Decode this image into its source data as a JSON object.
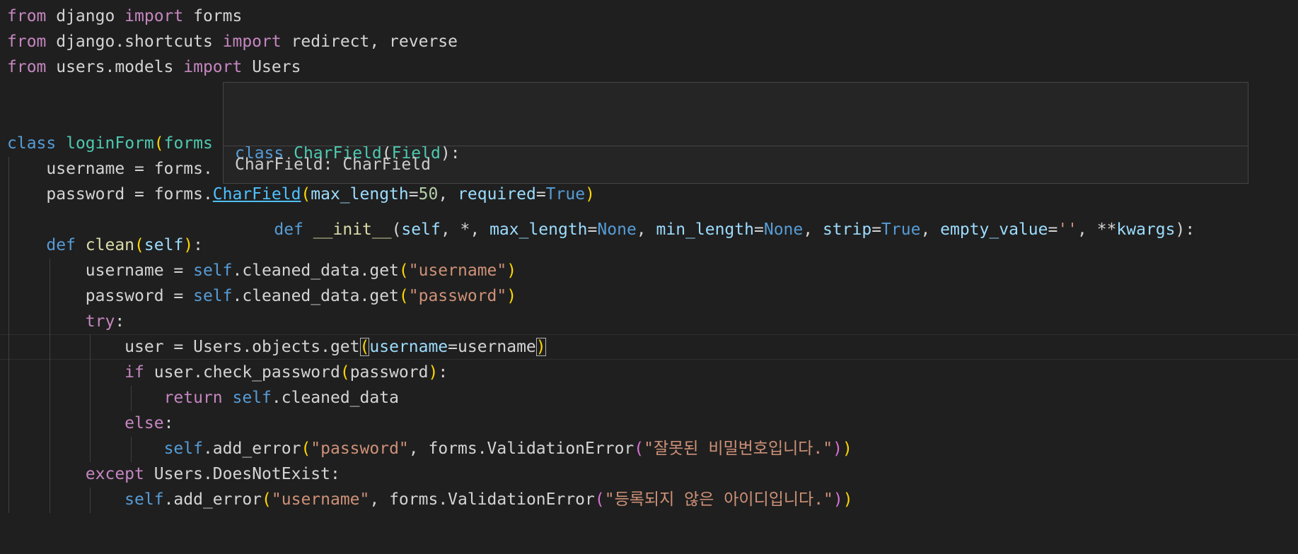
{
  "editor": {
    "lines": {
      "l1": {
        "from": "from",
        "mod": " django ",
        "import": "import",
        "name": " forms"
      },
      "l2": {
        "from": "from",
        "mod": " django.shortcuts ",
        "import": "import",
        "names": " redirect, reverse"
      },
      "l3": {
        "from": "from",
        "mod": " users.models ",
        "import": "import",
        "name": " Users"
      },
      "l6": {
        "kw": "class",
        "name": "loginForm",
        "paren": "(",
        "base": "forms"
      },
      "l7": {
        "indent": "    ",
        "var": "username",
        "rest": " = forms."
      },
      "l8": {
        "indent": "    ",
        "var": "password",
        "mid": " = forms.",
        "link": "CharField",
        "open": "(",
        "param1": "max_length",
        "eq1": "=",
        "num": "50",
        "comma": ", ",
        "param2": "required",
        "eq2": "=",
        "val": "True",
        "close": ")"
      },
      "l10": {
        "indent": "    ",
        "kw": "def",
        "name": "clean",
        "open": "(",
        "self": "self",
        "close": ")",
        "colon": ":"
      },
      "l11": {
        "indent": "        ",
        "var": "username",
        "eq": " = ",
        "self": "self",
        "rest": ".cleaned_data.get",
        "open": "(",
        "str": "\"username\"",
        "close": ")"
      },
      "l12": {
        "indent": "        ",
        "var": "password",
        "eq": " = ",
        "self": "self",
        "rest": ".cleaned_data.get",
        "open": "(",
        "str": "\"password\"",
        "close": ")"
      },
      "l13": {
        "indent": "        ",
        "kw": "try",
        "colon": ":"
      },
      "l14": {
        "indent": "            ",
        "var": "user",
        "rest": " = Users.objects.get",
        "open": "(",
        "param": "username",
        "eq": "=username",
        "close": ")"
      },
      "l15": {
        "indent": "            ",
        "kw": "if",
        "rest": " user.check_password",
        "open": "(",
        "arg": "password",
        "close": ")",
        "colon": ":"
      },
      "l16": {
        "indent": "                ",
        "kw": "return",
        "self": " self",
        "rest": ".cleaned_data"
      },
      "l17": {
        "indent": "            ",
        "kw": "else",
        "colon": ":"
      },
      "l18": {
        "indent": "                ",
        "self": "self",
        "rest": ".add_error",
        "open": "(",
        "str1": "\"password\"",
        "mid": ", forms.ValidationError",
        "open2": "(",
        "str2": "\"잘못된 비밀번호입니다.\"",
        "close2": ")",
        "close": ")"
      },
      "l19": {
        "indent": "        ",
        "kw": "except",
        "rest": " Users.DoesNotExist:"
      },
      "l20": {
        "indent": "            ",
        "self": "self",
        "rest": ".add_error",
        "open": "(",
        "str1": "\"username\"",
        "mid": ", forms.ValidationError",
        "open2": "(",
        "str2": "\"등록되지 않은 아이디입니다.\"",
        "close2": ")",
        "close": ")"
      }
    }
  },
  "hover": {
    "sig1": {
      "kw": "class",
      "name": "CharField",
      "open": "(",
      "base": "Field",
      "close": "):"
    },
    "sig2": {
      "indent": "    ",
      "kw": "def",
      "name": " __init__",
      "open": "(",
      "self": "self",
      "c1": ", *, ",
      "p1": "max_length",
      "e1": "=",
      "v1": "None",
      "c2": ", ",
      "p2": "min_length",
      "e2": "=",
      "v2": "None",
      "c3": ", ",
      "p3": "strip",
      "e3": "=",
      "v3": "True",
      "c4": ", ",
      "p4": "empty_value",
      "e4": "=",
      "v4": "''",
      "c5": ", **",
      "p5": "kwargs",
      "close": "):"
    },
    "doc": "CharField: CharField"
  }
}
